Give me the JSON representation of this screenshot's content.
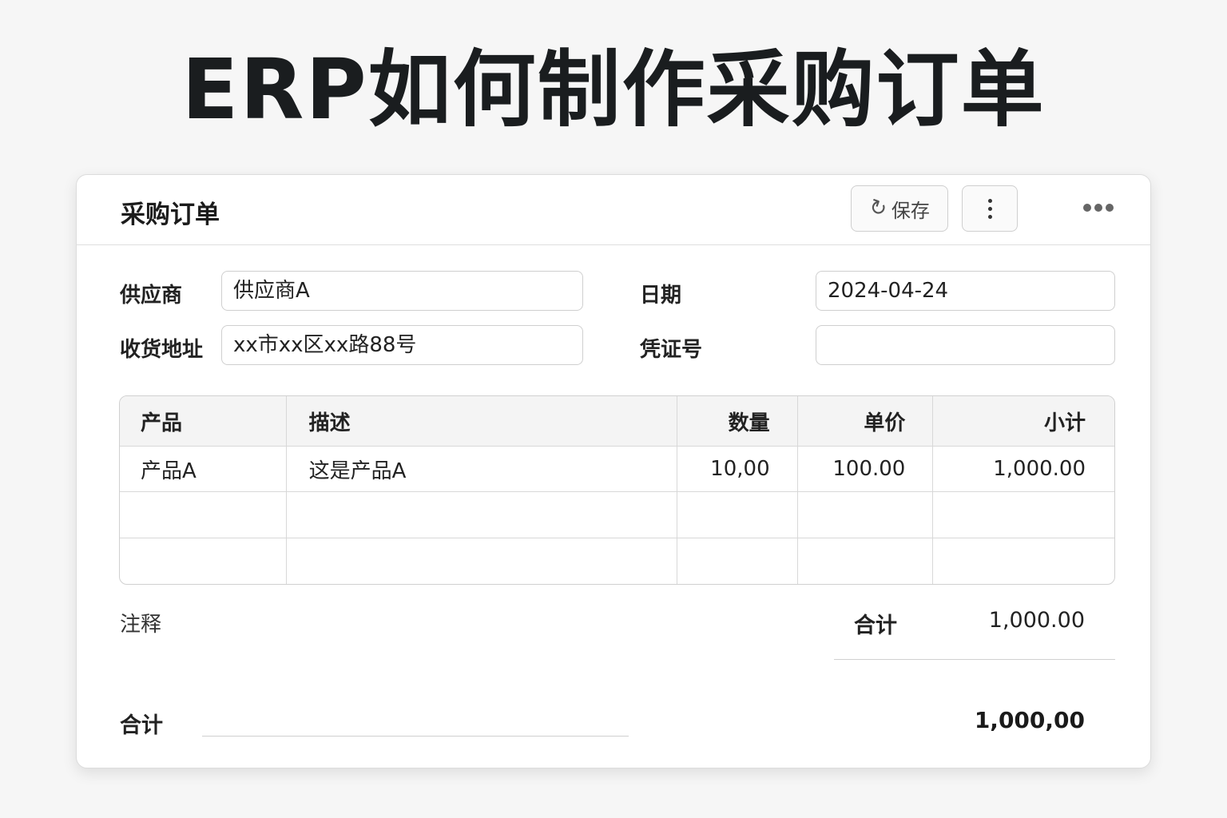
{
  "hero": {
    "title": "ERP如何制作采购订单"
  },
  "form": {
    "title": "采购订单",
    "save_label": "保存",
    "supplier_label": "供应商",
    "supplier_value": "供应商A",
    "address_label": "收货地址",
    "address_value": "xx市xx区xx路88号",
    "date_label": "日期",
    "date_value": "2024-04-24",
    "voucher_label": "凭证号",
    "voucher_value": ""
  },
  "table": {
    "headers": [
      "产品",
      "描述",
      "数量",
      "单价",
      "小计"
    ],
    "rows": [
      [
        "产品A",
        "这是产品A",
        "10,00",
        "100.00",
        "1,000.00"
      ],
      [
        "",
        "",
        "",
        "",
        ""
      ],
      [
        "",
        "",
        "",
        "",
        ""
      ]
    ]
  },
  "footer": {
    "notes_label": "注释",
    "subtotal_label": "合计",
    "subtotal_value": "1,000.00",
    "total_label": "合计",
    "total_value": "1,000,00"
  },
  "icons": {
    "save": "refresh-icon",
    "menu": "kebab-icon",
    "more": "more-icon"
  },
  "colors": {
    "background": "#f6f6f6",
    "card": "#ffffff",
    "border": "#d0d0d0",
    "text": "#1f1f1f"
  }
}
